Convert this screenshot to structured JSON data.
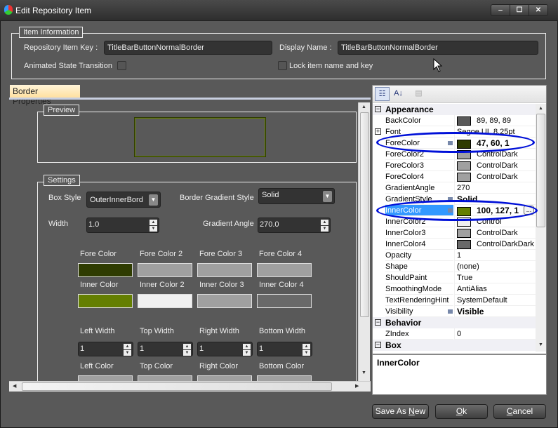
{
  "window": {
    "title": "Edit Repository Item",
    "minimize": "‒",
    "maximize": "☐",
    "close": "✕"
  },
  "item_info": {
    "group_label": "Item Information",
    "key_label": "Repository Item Key :",
    "key_value": "TitleBarButtonNormalBorder",
    "display_label": "Display Name :",
    "display_value": "TitleBarButtonNormalBorder",
    "animated_label": "Animated State Transition",
    "lock_label": "Lock item name and key"
  },
  "tab": {
    "label": "Border Properties"
  },
  "preview": {
    "label": "Preview",
    "border_color": "#647f01",
    "outer_color": "#2f3c01"
  },
  "settings": {
    "label": "Settings",
    "box_style_label": "Box Style",
    "box_style_value": "OuterInnerBord",
    "gradient_style_label": "Border Gradient Style",
    "gradient_style_value": "Solid",
    "width_label": "Width",
    "width_value": "1.0",
    "gradient_angle_label": "Gradient Angle",
    "gradient_angle_value": "270.0",
    "fore_colors": [
      {
        "label": "Fore Color",
        "color": "#2f3c01"
      },
      {
        "label": "Fore Color 2",
        "color": "#a0a0a0"
      },
      {
        "label": "Fore Color 3",
        "color": "#a0a0a0"
      },
      {
        "label": "Fore Color 4",
        "color": "#a0a0a0"
      }
    ],
    "inner_colors": [
      {
        "label": "Inner Color",
        "color": "#647f01"
      },
      {
        "label": "Inner Color 2",
        "color": "#f0f0f0"
      },
      {
        "label": "Inner Color 3",
        "color": "#a0a0a0"
      },
      {
        "label": "Inner Color 4",
        "color": "#696969"
      }
    ],
    "widths": [
      {
        "label": "Left Width",
        "value": "1"
      },
      {
        "label": "Top Width",
        "value": "1"
      },
      {
        "label": "Right Width",
        "value": "1"
      },
      {
        "label": "Bottom Width",
        "value": "1"
      }
    ],
    "side_colors": [
      {
        "label": "Left Color",
        "color": "#a0a0a0"
      },
      {
        "label": "Top Color",
        "color": "#a0a0a0"
      },
      {
        "label": "Right Color",
        "color": "#a0a0a0"
      },
      {
        "label": "Bottom Color",
        "color": "#a0a0a0"
      }
    ]
  },
  "property_grid": {
    "rows": [
      {
        "type": "cat",
        "name": "Appearance"
      },
      {
        "name": "BackColor",
        "swatch": "#595959",
        "value": "89, 89, 89"
      },
      {
        "name": "Font",
        "value": "Segoe UI, 8.25pt",
        "expand": "+"
      },
      {
        "name": "ForeColor",
        "swatch": "#2f3c01",
        "value": "47, 60, 1",
        "bold": true,
        "mark": true
      },
      {
        "name": "ForeColor2",
        "swatch": "#a0a0a0",
        "value": "ControlDark"
      },
      {
        "name": "ForeColor3",
        "swatch": "#a0a0a0",
        "value": "ControlDark"
      },
      {
        "name": "ForeColor4",
        "swatch": "#a0a0a0",
        "value": "ControlDark"
      },
      {
        "name": "GradientAngle",
        "value": "270"
      },
      {
        "name": "GradientStyle",
        "value": "Solid",
        "bold": true,
        "mark": true
      },
      {
        "name": "InnerColor",
        "swatch": "#647f01",
        "value": "100, 127, 1",
        "bold": true,
        "mark": true,
        "selected": true
      },
      {
        "name": "InnerColor2",
        "swatch": "#f0f0f0",
        "value": "Control"
      },
      {
        "name": "InnerColor3",
        "swatch": "#a0a0a0",
        "value": "ControlDark"
      },
      {
        "name": "InnerColor4",
        "swatch": "#696969",
        "value": "ControlDarkDark"
      },
      {
        "name": "Opacity",
        "value": "1"
      },
      {
        "name": "Shape",
        "value": "(none)"
      },
      {
        "name": "ShouldPaint",
        "value": "True"
      },
      {
        "name": "SmoothingMode",
        "value": "AntiAlias"
      },
      {
        "name": "TextRenderingHint",
        "value": "SystemDefault"
      },
      {
        "name": "Visibility",
        "value": "Visible",
        "bold": true,
        "mark": true
      },
      {
        "type": "cat",
        "name": "Behavior"
      },
      {
        "name": "ZIndex",
        "value": "0"
      },
      {
        "type": "cat",
        "name": "Box"
      }
    ],
    "description_title": "InnerColor",
    "ellipsis": "..."
  },
  "buttons": {
    "save_as_new_pre": "Save As ",
    "save_as_new_key": "N",
    "save_as_new_post": "ew",
    "ok_key": "O",
    "ok_post": "k",
    "cancel_key": "C",
    "cancel_post": "ancel"
  }
}
